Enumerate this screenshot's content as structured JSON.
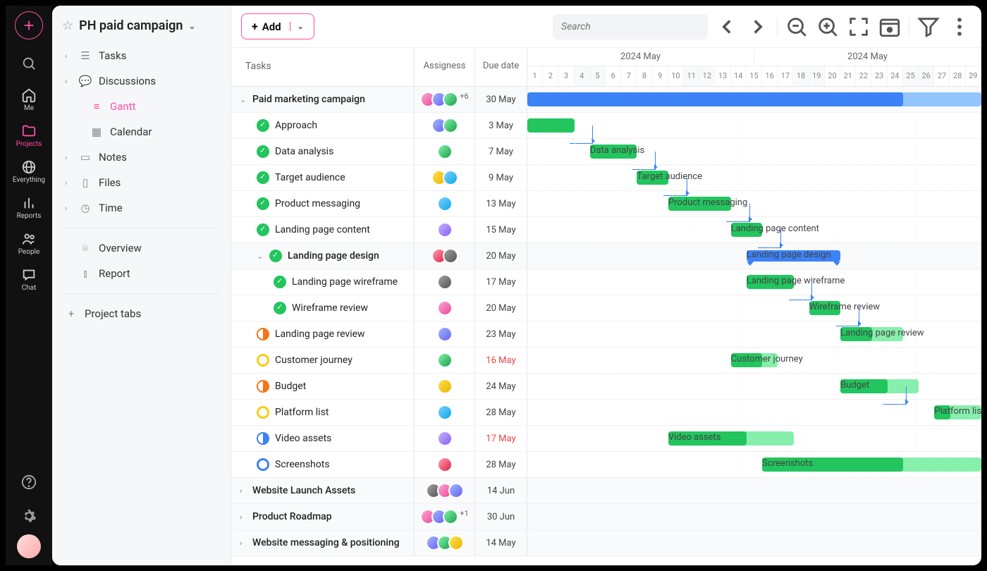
{
  "rail": {
    "items": [
      {
        "label": "Me",
        "icon": "home"
      },
      {
        "label": "Projects",
        "icon": "folder",
        "active": true
      },
      {
        "label": "Everything",
        "icon": "globe"
      },
      {
        "label": "Reports",
        "icon": "bar-chart"
      },
      {
        "label": "People",
        "icon": "users"
      },
      {
        "label": "Chat",
        "icon": "chat"
      }
    ]
  },
  "project": {
    "title": "PH paid campaign"
  },
  "sidebar": {
    "sections": [
      {
        "label": "Tasks",
        "icon": "list",
        "expandable": true
      },
      {
        "label": "Discussions",
        "icon": "chat-bubble",
        "expandable": true
      },
      {
        "label": "Gantt",
        "icon": "gantt",
        "indent": true,
        "active": true
      },
      {
        "label": "Calendar",
        "icon": "calendar",
        "indent": true
      },
      {
        "label": "Notes",
        "icon": "note",
        "expandable": true
      },
      {
        "label": "Files",
        "icon": "file",
        "expandable": true
      },
      {
        "label": "Time",
        "icon": "clock",
        "expandable": true
      }
    ],
    "secondary": [
      {
        "label": "Overview",
        "icon": "dashboard"
      },
      {
        "label": "Report",
        "icon": "report"
      }
    ],
    "project_tabs": "Project tabs"
  },
  "toolbar": {
    "add_label": "Add",
    "search_placeholder": "Search"
  },
  "columns": {
    "tasks": "Tasks",
    "assignees": "Assigness",
    "due": "Due date"
  },
  "timeline": {
    "months": [
      "2024 May",
      "2024 May"
    ],
    "days": [
      1,
      2,
      3,
      4,
      5,
      6,
      7,
      8,
      9,
      10,
      11,
      12,
      13,
      14,
      15,
      16,
      17,
      18,
      19,
      20,
      21,
      22,
      23,
      24,
      25,
      26,
      27,
      28,
      29
    ],
    "weekend_days": [
      4,
      5,
      11,
      12,
      18,
      19,
      25,
      26
    ]
  },
  "rows": [
    {
      "type": "group",
      "name": "Paid marketing campaign",
      "assignees": 3,
      "more": "+6",
      "due": "30 May",
      "bar": {
        "color": "blue",
        "start": 1,
        "end": 24,
        "light_end": 29
      }
    },
    {
      "type": "task",
      "indent": 1,
      "status": "done",
      "name": "Approach",
      "assignees": 2,
      "due": "3 May",
      "bar": {
        "color": "green",
        "start": 1,
        "end": 3
      },
      "dep_to_next": true
    },
    {
      "type": "task",
      "indent": 1,
      "status": "done",
      "name": "Data analysis",
      "assignees": 1,
      "due": "7 May",
      "bar": {
        "color": "green",
        "start": 5,
        "end": 7,
        "label": "Data analysis"
      },
      "dep_to_next": true
    },
    {
      "type": "task",
      "indent": 1,
      "status": "done",
      "name": "Target audience",
      "assignees": 2,
      "due": "9 May",
      "bar": {
        "color": "green",
        "start": 8,
        "end": 9,
        "label": "Target audience"
      },
      "dep_to_next": true
    },
    {
      "type": "task",
      "indent": 1,
      "status": "done",
      "name": "Product messaging",
      "assignees": 1,
      "due": "13 May",
      "bar": {
        "color": "green",
        "start": 10,
        "end": 13,
        "label": "Product messaging"
      },
      "dep_to_next": true
    },
    {
      "type": "task",
      "indent": 1,
      "status": "done",
      "name": "Landing page content",
      "assignees": 1,
      "due": "15 May",
      "bar": {
        "color": "green",
        "start": 14,
        "end": 15,
        "label": "Landing page content"
      },
      "dep_to_next": true
    },
    {
      "type": "group",
      "indent": 1,
      "status": "done",
      "name": "Landing page design",
      "assignees": 2,
      "due": "20 May",
      "bar": {
        "color": "blue",
        "parent": true,
        "start": 15,
        "end": 20,
        "label": "Landing page design"
      }
    },
    {
      "type": "task",
      "indent": 2,
      "status": "done",
      "name": "Landing page wireframe",
      "assignees": 1,
      "due": "17 May",
      "bar": {
        "color": "green",
        "start": 15,
        "end": 17,
        "label": "Landing page wireframe"
      },
      "dep_to_next": true
    },
    {
      "type": "task",
      "indent": 2,
      "status": "done",
      "name": "Wireframe review",
      "assignees": 1,
      "due": "20 May",
      "bar": {
        "color": "green",
        "start": 19,
        "end": 20,
        "label": "Wireframe review"
      },
      "dep_to_next": true
    },
    {
      "type": "task",
      "indent": 1,
      "status": "half-orange",
      "name": "Landing page review",
      "assignees": 1,
      "due": "23 May",
      "bar": {
        "color": "green",
        "start": 21,
        "end": 22,
        "light_end": 24,
        "label": "Landing page review"
      }
    },
    {
      "type": "task",
      "indent": 1,
      "status": "ring-yellow",
      "name": "Customer journey",
      "assignees": 1,
      "due": "16 May",
      "overdue": true,
      "bar": {
        "color": "green",
        "start": 14,
        "end": 15,
        "light_end": 16,
        "label": "Customer journey"
      }
    },
    {
      "type": "task",
      "indent": 1,
      "status": "half-orange",
      "name": "Budget",
      "assignees": 1,
      "due": "24 May",
      "bar": {
        "color": "green",
        "start": 21,
        "end": 23,
        "light_end": 25,
        "label": "Budget"
      },
      "dep_to_next": true
    },
    {
      "type": "task",
      "indent": 1,
      "status": "ring-yellow",
      "name": "Platform list",
      "assignees": 1,
      "due": "28 May",
      "bar": {
        "color": "green",
        "start": 27,
        "end": 27,
        "light_end": 29,
        "label": "Platform list"
      }
    },
    {
      "type": "task",
      "indent": 1,
      "status": "half-blue",
      "name": "Video assets",
      "assignees": 1,
      "due": "17 May",
      "overdue": true,
      "bar": {
        "color": "green",
        "start": 10,
        "end": 14,
        "light_end": 17,
        "label": "Video assets"
      }
    },
    {
      "type": "task",
      "indent": 1,
      "status": "ring-blue",
      "name": "Screenshots",
      "assignees": 1,
      "due": "28 May",
      "bar": {
        "color": "green",
        "start": 16,
        "end": 24,
        "light_end": 29,
        "label": "Screenshots"
      }
    },
    {
      "type": "group",
      "name": "Website Launch Assets",
      "assignees": 3,
      "due": "14 Jun",
      "collapsed": true
    },
    {
      "type": "group",
      "name": "Product Roadmap",
      "assignees": 3,
      "more": "+1",
      "due": "30 Jun",
      "collapsed": true
    },
    {
      "type": "group",
      "name": "Website messaging & positioning",
      "assignees": 3,
      "due": "14 May",
      "collapsed": true
    }
  ]
}
